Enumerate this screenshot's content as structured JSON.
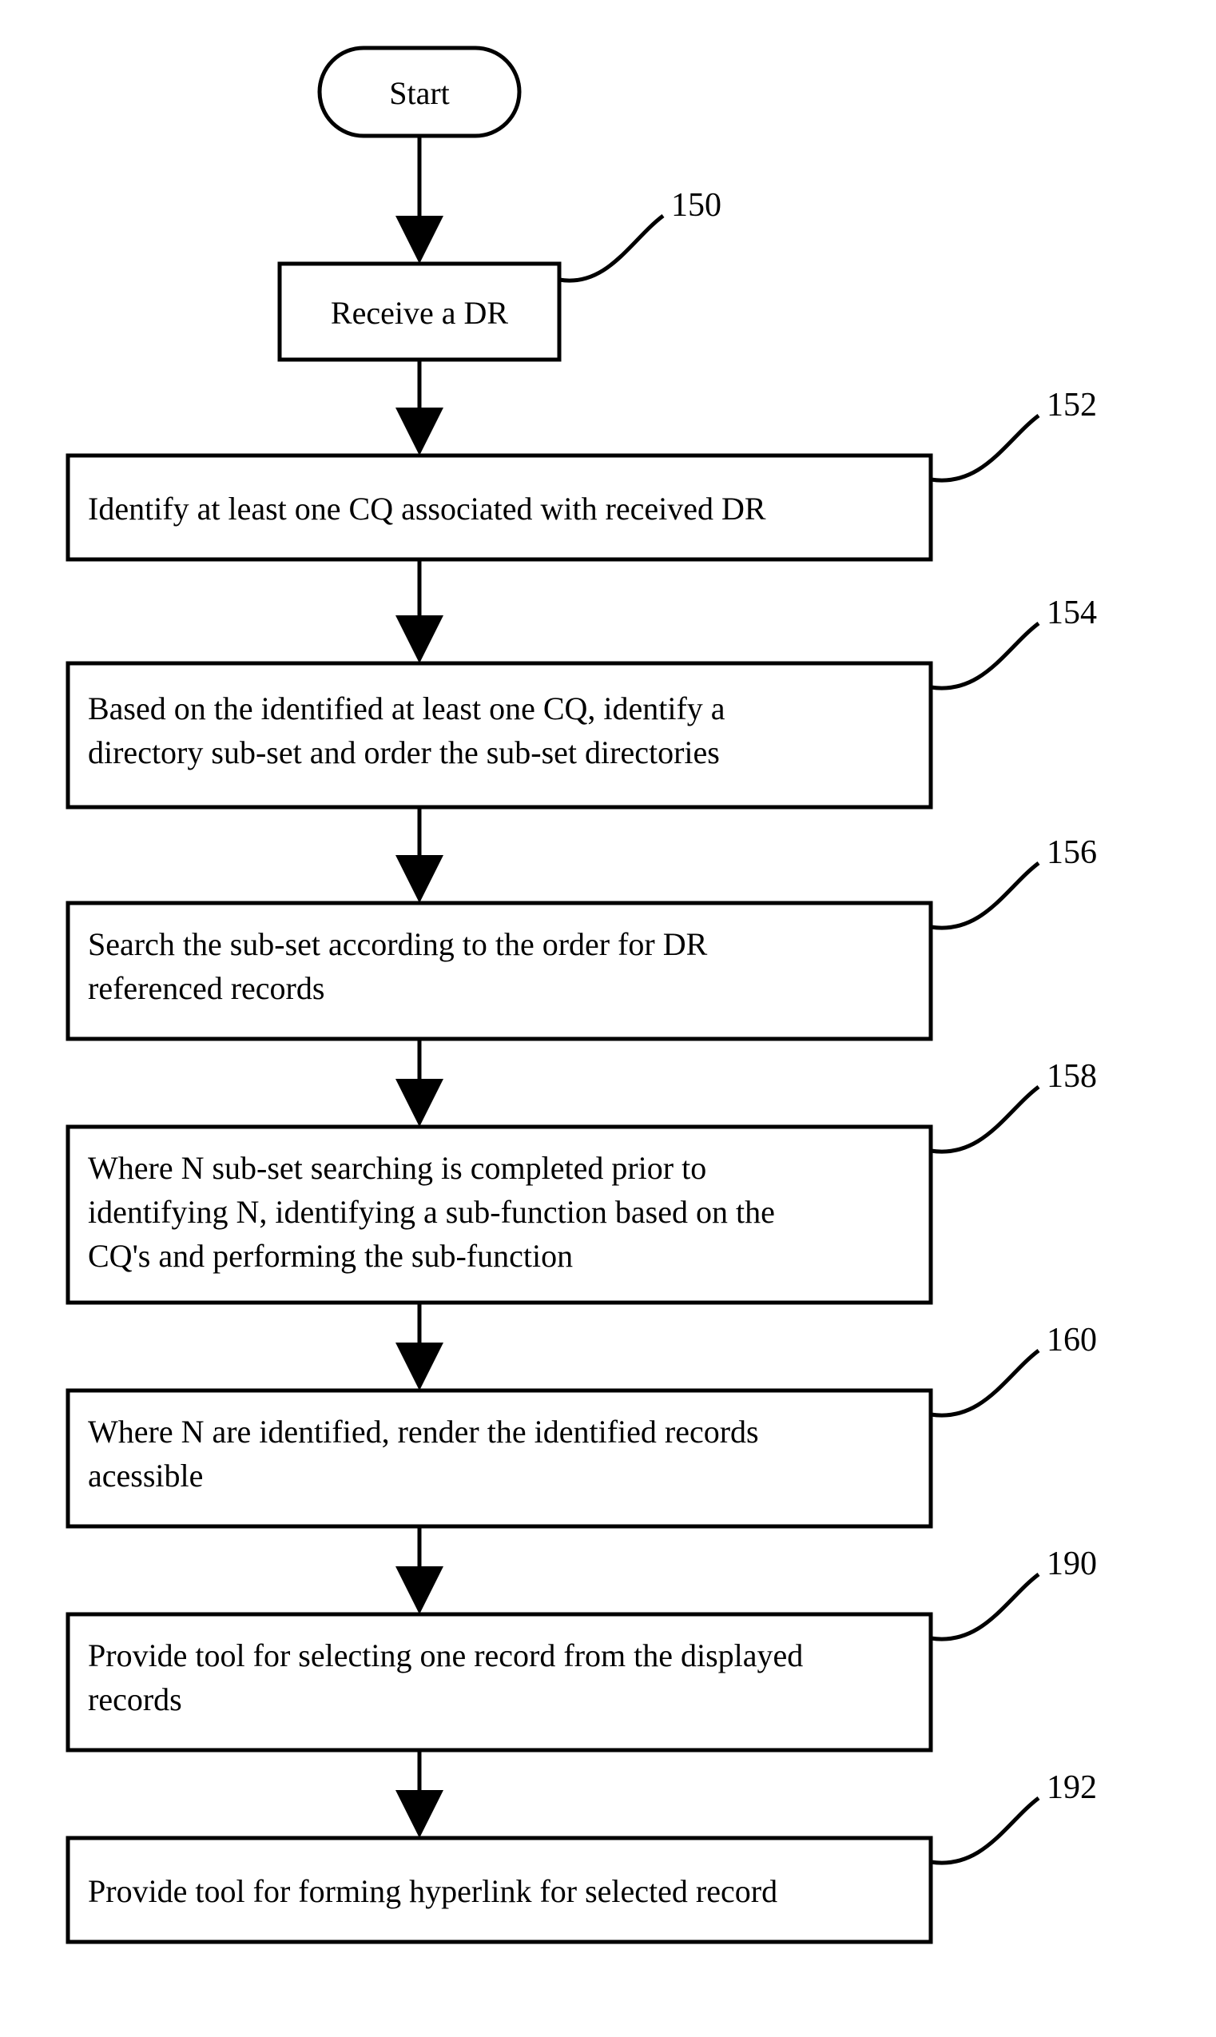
{
  "flowchart": {
    "start": "Start",
    "steps": [
      {
        "id": "150",
        "text": "Receive a DR"
      },
      {
        "id": "152",
        "text": "Identify at least one CQ associated with received DR"
      },
      {
        "id": "154",
        "text": "Based on the identified at least one CQ, identify a directory sub-set and order the sub-set directories"
      },
      {
        "id": "156",
        "text": "Search the sub-set according to the order for DR referenced records"
      },
      {
        "id": "158",
        "text": "Where N sub-set searching is completed prior to identifying N, identifying a sub-function based on the CQ's and performing the sub-function"
      },
      {
        "id": "160",
        "text": "Where N are identified, render the identified records acessible"
      },
      {
        "id": "190",
        "text": "Provide tool for selecting one record from the displayed records"
      },
      {
        "id": "192",
        "text": "Provide tool for forming hyperlink for selected record"
      }
    ]
  }
}
